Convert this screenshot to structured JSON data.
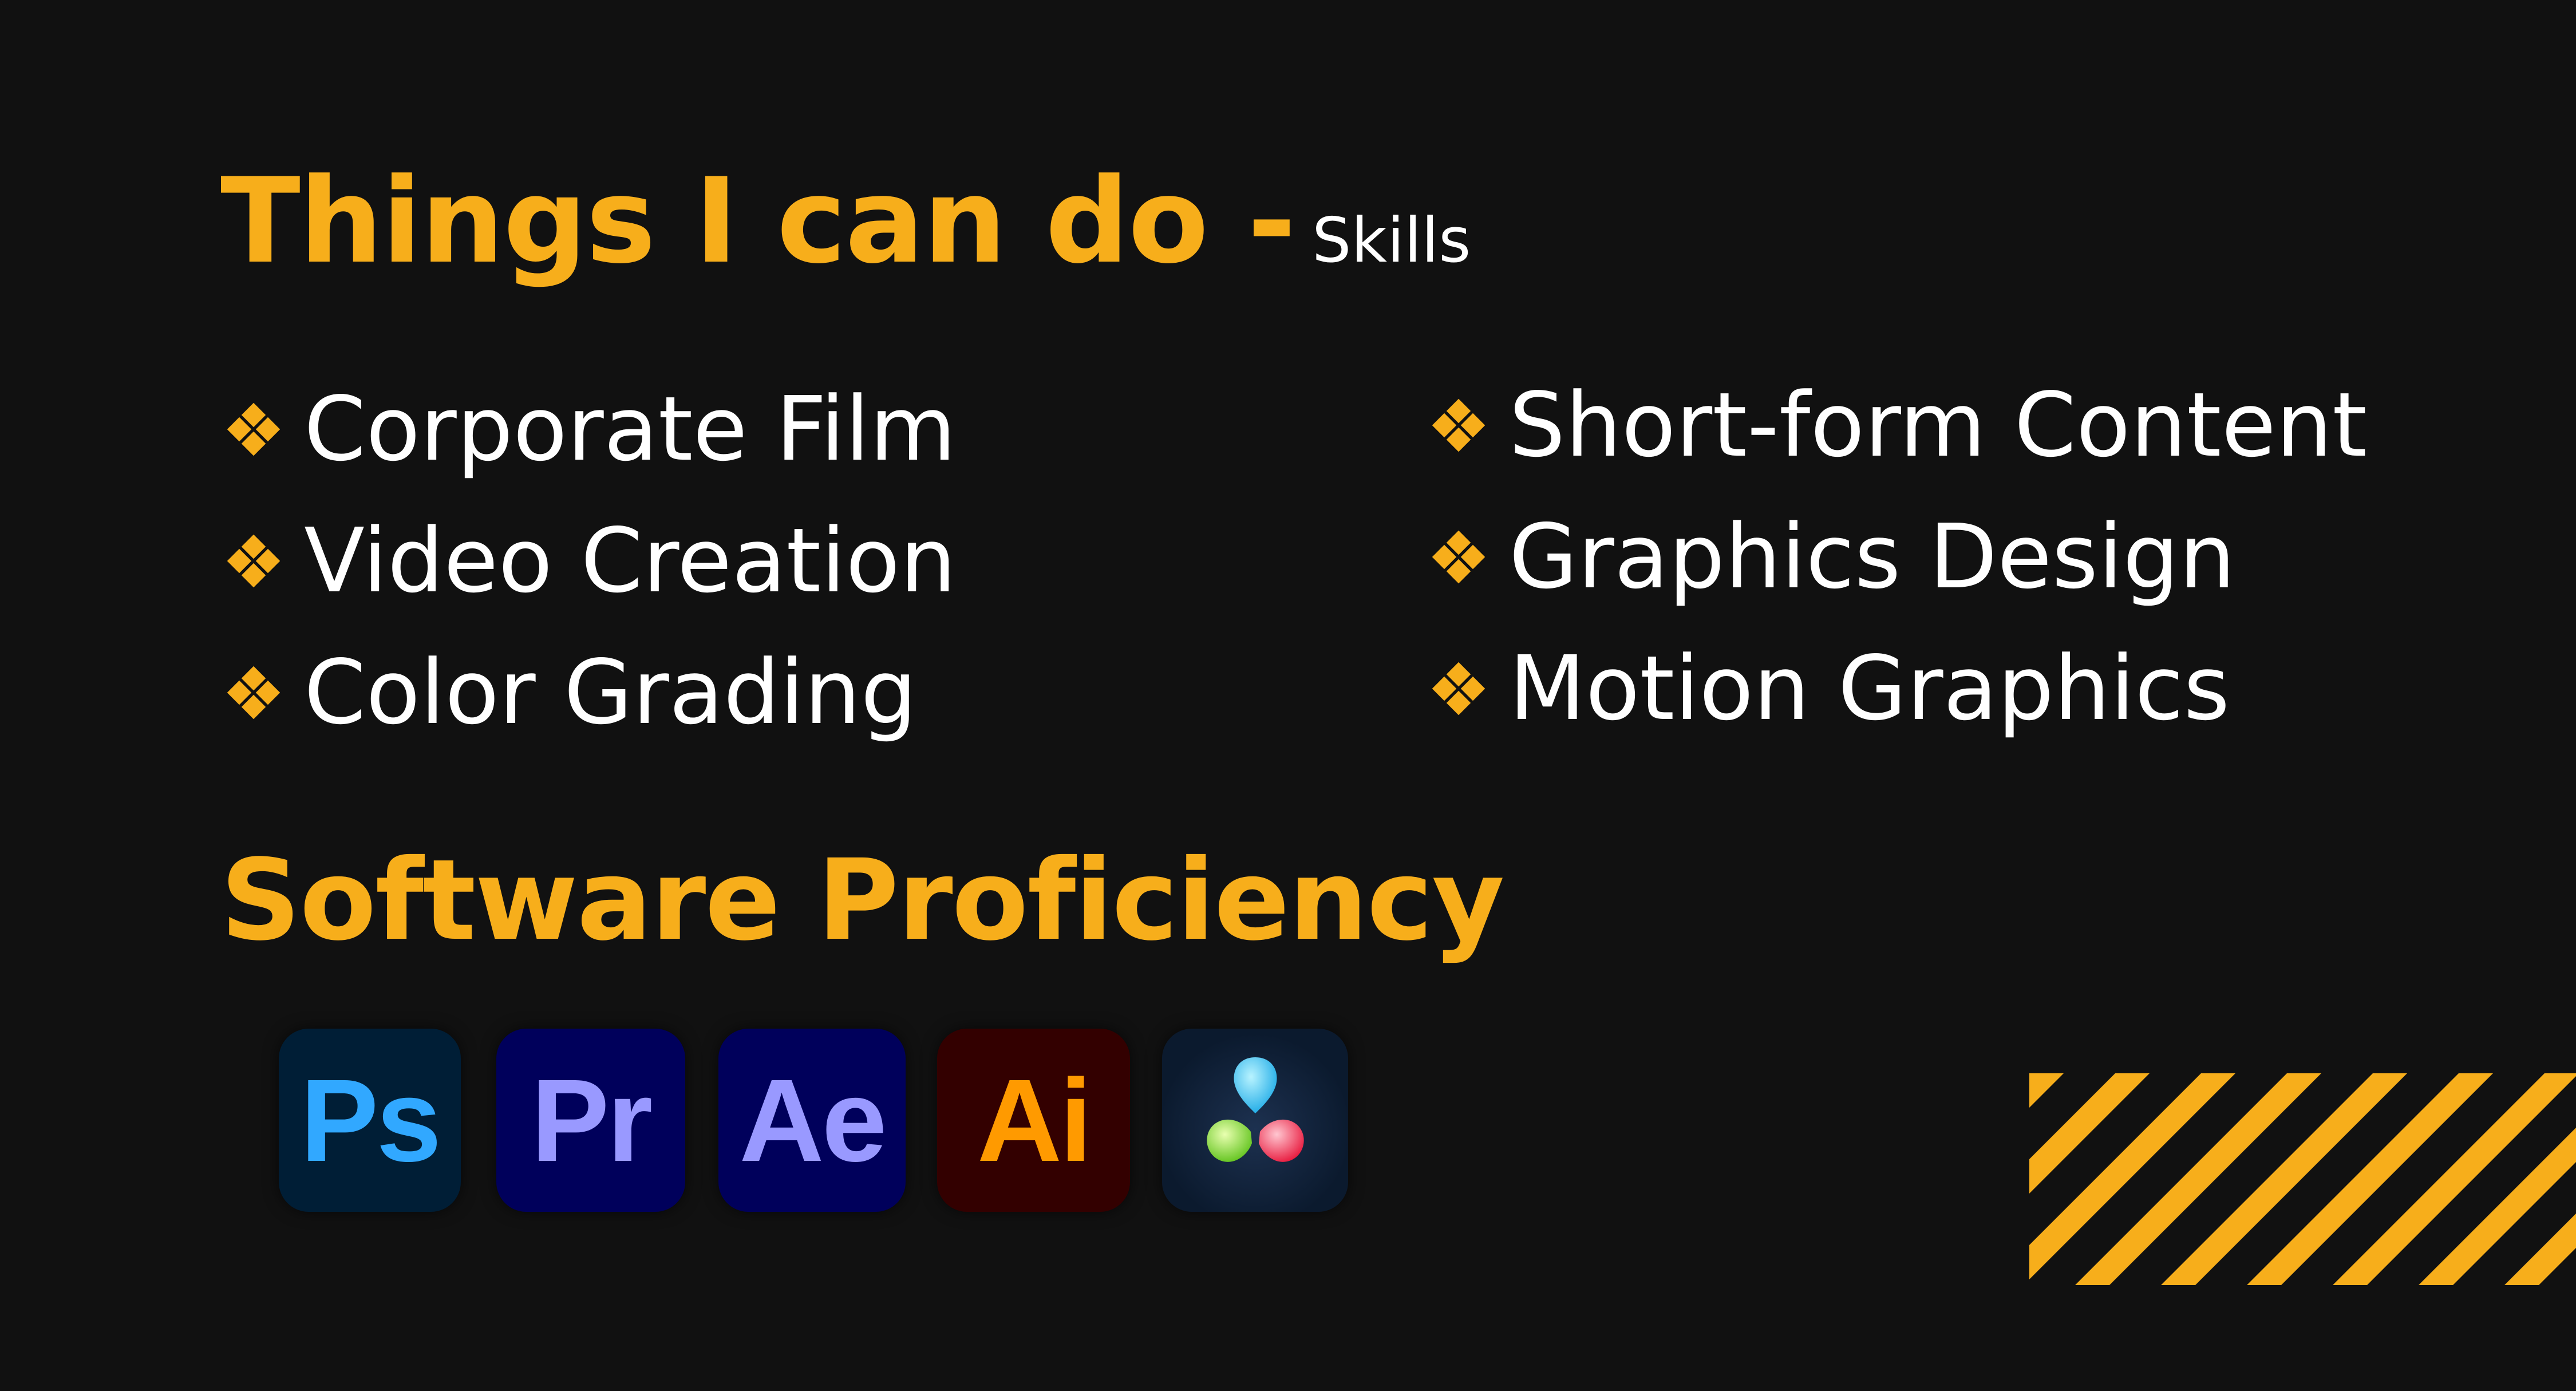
{
  "skills_section": {
    "title": "Things I can do -",
    "subtitle": "Skills",
    "left_items": [
      {
        "label": "Corporate Film"
      },
      {
        "label": "Video Creation"
      },
      {
        "label": "Color Grading"
      }
    ],
    "right_items": [
      {
        "label": "Short-form Content"
      },
      {
        "label": "Graphics Design"
      },
      {
        "label": "Motion Graphics"
      }
    ],
    "bullet_icon": "four-diamond-icon"
  },
  "software_section": {
    "title": "Software Proficiency",
    "apps": [
      {
        "label": "Ps",
        "icon": "photoshop-icon",
        "bg": "#001e36",
        "fg": "#31a8ff"
      },
      {
        "label": "Pr",
        "icon": "premiere-pro-icon",
        "bg": "#00005b",
        "fg": "#9999ff"
      },
      {
        "label": "Ae",
        "icon": "after-effects-icon",
        "bg": "#00005b",
        "fg": "#9999ff"
      },
      {
        "label": "Ai",
        "icon": "illustrator-icon",
        "bg": "#330000",
        "fg": "#ff9a00"
      },
      {
        "icon": "davinci-resolve-icon",
        "bg": "#0b1a2e"
      }
    ]
  },
  "colors": {
    "accent": "#f7ae1b",
    "background": "#111111",
    "text": "#ffffff"
  },
  "decoration": {
    "icon": "diagonal-stripes-icon"
  }
}
